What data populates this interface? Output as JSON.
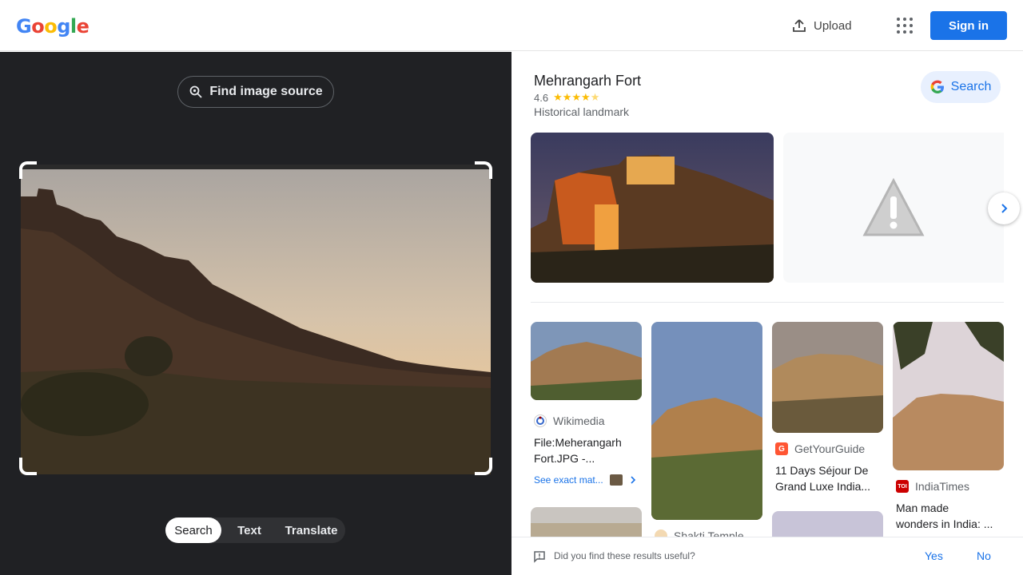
{
  "header": {
    "logo": [
      "G",
      "o",
      "o",
      "g",
      "l",
      "e"
    ],
    "logo_colors": [
      "#4285F4",
      "#EA4335",
      "#FBBC05",
      "#4285F4",
      "#34A853",
      "#EA4335"
    ],
    "upload_label": "Upload",
    "signin_label": "Sign in"
  },
  "left": {
    "find_source_label": "Find image source",
    "modes": [
      "Search",
      "Text",
      "Translate"
    ],
    "active_mode": "Search"
  },
  "knowledge": {
    "title": "Mehrangarh Fort",
    "rating": "4.6",
    "stars_value": 4.6,
    "type": "Historical landmark",
    "search_label": "Search"
  },
  "results": [
    {
      "source": "Wikimedia",
      "title_line1": "File:Meherangarh",
      "title_line2": "Fort.JPG -...",
      "icon_color": "#3366cc"
    },
    {
      "source": "Shakti Temple",
      "title_line1": "",
      "title_line2": ""
    },
    {
      "source": "GetYourGuide",
      "title_line1": "11 Days Séjour De",
      "title_line2": "Grand Luxe India...",
      "icon_color": "#ff5533"
    },
    {
      "source": "IndiaTimes",
      "title_line1": "Man made",
      "title_line2": "wonders in India: ...",
      "icon_color": "#cc0000",
      "icon_text": "TOI"
    }
  ],
  "see_exact_label": "See exact mat...",
  "feedback": {
    "question": "Did you find these results useful?",
    "yes": "Yes",
    "no": "No"
  }
}
